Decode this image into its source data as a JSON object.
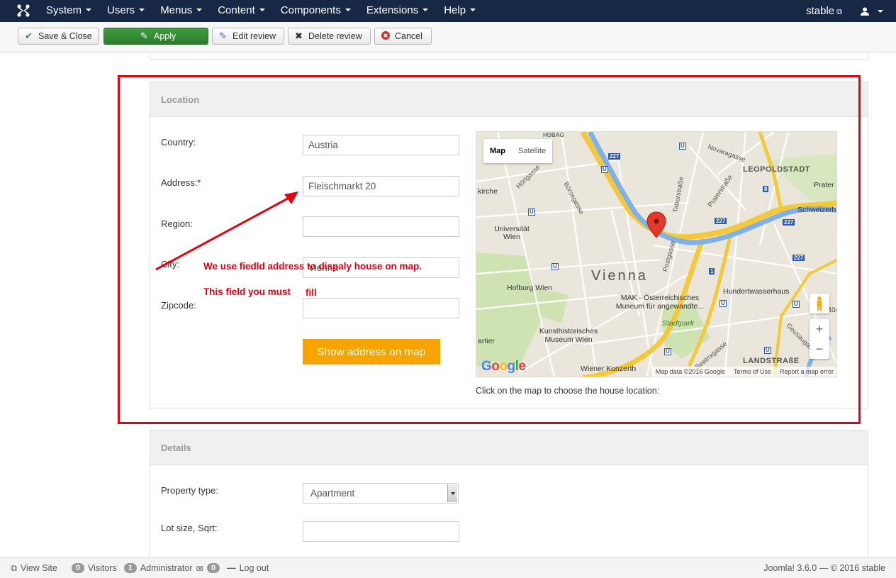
{
  "navbar": {
    "menu": [
      "System",
      "Users",
      "Menus",
      "Content",
      "Components",
      "Extensions",
      "Help"
    ],
    "site_name": "stable"
  },
  "toolbar": {
    "save_close": "Save & Close",
    "apply": "Apply",
    "edit_review": "Edit review",
    "delete_review": "Delete review",
    "cancel": "Cancel"
  },
  "location": {
    "title": "Location",
    "country_label": "Country:",
    "country_value": "Austria",
    "address_label": "Address:*",
    "address_value": "Fleischmarkt 20",
    "region_label": "Region:",
    "region_value": "",
    "city_label": "City:",
    "city_value": "Vienna",
    "zipcode_label": "Zipcode:",
    "zipcode_value": "",
    "show_button": "Show address on map",
    "map_caption": "Click on the map to choose the house location:"
  },
  "map": {
    "type_map": "Map",
    "type_satellite": "Satellite",
    "labels": {
      "vienna": "Vienna",
      "universitat": "Universität Wien",
      "hofburg": "Hofburg Wien",
      "mak": "MAK - Österreichisches Museum für angewandte...",
      "kunst": "Kunsthistorisches Museum Wien",
      "leopoldstadt": "LEOPOLDSTADT",
      "landstrasse": "LANDSTRAßE",
      "stadtpark": "Stadtpark",
      "hundertwasser": "Hundertwasserhaus",
      "prater": "Prater",
      "schweizer": "Schweizerh",
      "horlgasse": "Hörlgasse",
      "borsegasse": "Börsegasse",
      "taborstrasse": "Taborstraße",
      "praterstrasse": "Praterstraße",
      "postgasse": "Postgasse",
      "novaragasse": "Novaragasse",
      "beatrixgasse": "Beatrixgasse",
      "geusaugasse": "Geusaugasse",
      "wiener_konzerth": "Wiener Konzerth",
      "kirche": "kirche",
      "artier": "artier",
      "hobag": "HOBAG",
      "boc": "Böc",
      "road_227": "227",
      "road_1": "1",
      "road_8": "8",
      "metro": "U"
    },
    "footer_data": "Map data ©2016 Google",
    "footer_terms": "Terms of Use",
    "footer_report": "Report a map error"
  },
  "annotation": {
    "line1": "We use fiedld address to dispaly house on map.",
    "line2a": "This field you must",
    "line2b": "fill"
  },
  "details": {
    "title": "Details",
    "property_type_label": "Property type:",
    "property_type_value": "Apartment",
    "lot_size_label": "Lot size, Sqrt:",
    "lot_size_value": ""
  },
  "statusbar": {
    "view_site": "View Site",
    "visitors_count": "0",
    "visitors_label": "Visitors",
    "admin_count": "1",
    "admin_label": "Administrator",
    "messages_count": "0",
    "logout": "Log out",
    "version": "Joomla! 3.6.0 — © 2016 stable"
  },
  "colors": {
    "navbar": "#172847",
    "apply": "#2f8a2f",
    "show_button": "#f7a400",
    "annotation": "#e8000d"
  }
}
